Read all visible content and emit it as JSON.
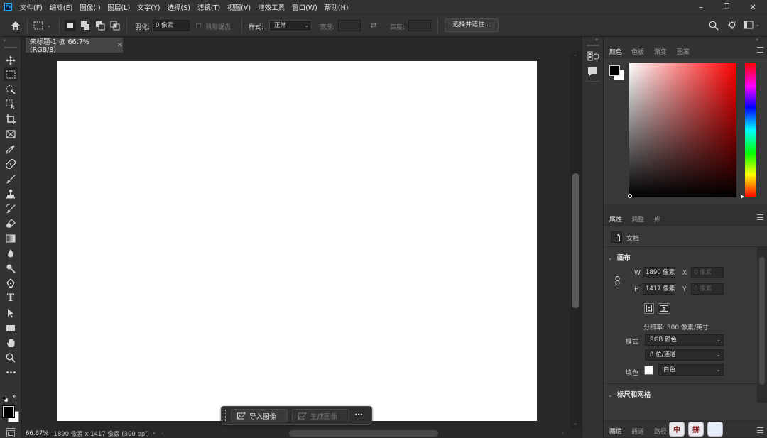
{
  "app": {
    "logo_text": "Ps"
  },
  "menubar": {
    "items": [
      "文件(F)",
      "编辑(E)",
      "图像(I)",
      "图层(L)",
      "文字(Y)",
      "选择(S)",
      "滤镜(T)",
      "视图(V)",
      "增效工具",
      "窗口(W)",
      "帮助(H)"
    ],
    "minimize": "–",
    "restore": "❐",
    "close": "✕"
  },
  "options": {
    "feather_label": "羽化:",
    "feather_value": "0 像素",
    "antialias_label": "消除锯齿",
    "style_label": "样式:",
    "style_value": "正常",
    "width_label": "宽度:",
    "height_label": "高度:",
    "select_mask_button": "选择并遮住..."
  },
  "document": {
    "tab_title": "未标题-1 @ 66.7%(RGB/8)",
    "tab_close": "×",
    "zoom": "66.67%",
    "info": "1890 像素 x 1417 像素 (300 ppi)",
    "info_arrow": "›"
  },
  "taskbar": {
    "import_image": "导入图像",
    "generate_image": "生成图像",
    "more": "•••"
  },
  "color_panel": {
    "tabs": [
      "颜色",
      "色板",
      "渐变",
      "图案"
    ],
    "foreground": "#000000",
    "background": "#ffffff",
    "hue_color": "#ff0000"
  },
  "properties_panel": {
    "tabs": [
      "属性",
      "调整",
      "库"
    ],
    "doc_label": "文档",
    "canvas_section": "画布",
    "w_label": "W",
    "w_value": "1890 像素",
    "h_label": "H",
    "h_value": "1417 像素",
    "x_label": "X",
    "x_value": "0 像素",
    "y_label": "Y",
    "y_value": "0 像素",
    "resolution": "分辨率: 300 像素/英寸",
    "mode_label": "模式",
    "mode_value": "RGB 颜色",
    "depth_value": "8 位/通道",
    "fill_label": "填色",
    "fill_value": "白色",
    "rulers_section": "标尺和网格"
  },
  "layers_panel": {
    "tabs": [
      "图层",
      "通道",
      "路径"
    ]
  },
  "ime": [
    "中",
    "拼",
    ""
  ]
}
